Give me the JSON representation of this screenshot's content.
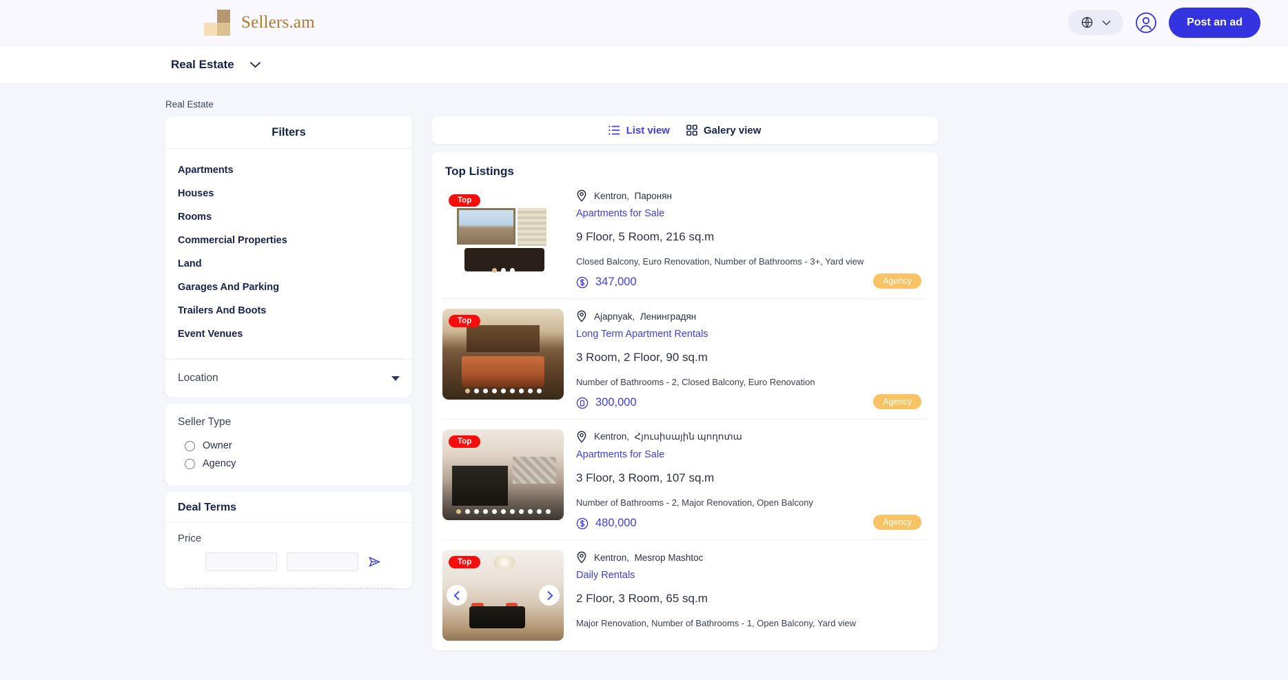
{
  "header": {
    "brand_name": "Sellers.am",
    "language_icon": "globe-icon",
    "post_ad_label": "Post an ad"
  },
  "category_bar": {
    "current_category": "Real Estate"
  },
  "breadcrumb": "Real Estate",
  "sidebar": {
    "filters_title": "Filters",
    "categories": [
      {
        "label": "Apartments"
      },
      {
        "label": "Houses"
      },
      {
        "label": "Rooms"
      },
      {
        "label": "Commercial Properties"
      },
      {
        "label": "Land"
      },
      {
        "label": "Garages And Parking"
      },
      {
        "label": "Trailers And Boots"
      },
      {
        "label": "Event Venues"
      }
    ],
    "location": {
      "label": "Location"
    },
    "seller_type": {
      "title": "Seller Type",
      "options": [
        {
          "label": "Owner",
          "selected": false
        },
        {
          "label": "Agency",
          "selected": false
        }
      ]
    },
    "deal_terms": {
      "title": "Deal Terms",
      "price_label": "Price",
      "price_from": "",
      "price_to": "",
      "price_from_placeholder": "",
      "price_to_placeholder": "",
      "submit_icon": "send-arrow-icon"
    }
  },
  "main": {
    "views": [
      {
        "label": "List view",
        "icon": "list-icon",
        "active": true
      },
      {
        "label": "Galery view",
        "icon": "grid-icon",
        "active": false
      }
    ],
    "listings_title": "Top Listings",
    "listings": [
      {
        "badge": "Top",
        "region": "Kentron",
        "street": "Паронян",
        "title": "Apartments for Sale",
        "specs": "9 Floor, 5 Room, 216 sq.m",
        "attributes": "Closed Balcony,  Euro Renovation,  Number of Bathrooms - 3+,  Yard view",
        "currency_icon": "dollar-circle-icon",
        "price": "347,000",
        "tag": "Agency",
        "dots_total": 3,
        "dots_active": 0
      },
      {
        "badge": "Top",
        "region": "Ajapnyak",
        "street": "Ленинградян",
        "title": "Long Term Apartment Rentals",
        "specs": "3 Room, 2 Floor, 90 sq.m",
        "attributes": "Number of Bathrooms - 2,  Closed Balcony,  Euro Renovation",
        "currency_icon": "dram-circle-icon",
        "price": "300,000",
        "tag": "Agency",
        "dots_total": 9,
        "dots_active": 0
      },
      {
        "badge": "Top",
        "region": "Kentron",
        "street": "Հյուսիսային պողոտա",
        "title": "Apartments for Sale",
        "specs": "3 Floor, 3 Room, 107 sq.m",
        "attributes": "Number of Bathrooms - 2,  Major Renovation,  Open Balcony",
        "currency_icon": "dollar-circle-icon",
        "price": "480,000",
        "tag": "Agency",
        "dots_total": 11,
        "dots_active": 0
      },
      {
        "badge": "Top",
        "region": "Kentron",
        "street": "Mesrop Mashtoc",
        "title": "Daily Rentals",
        "specs": "2 Floor, 3 Room, 65 sq.m",
        "attributes": "Major Renovation,  Number of Bathrooms - 1,  Open Balcony,  Yard view",
        "currency_icon": "dollar-circle-icon",
        "price": "",
        "tag": "",
        "dots_total": 0,
        "dots_active": 0,
        "show_nav_arrows": true
      }
    ]
  },
  "colors": {
    "accent_blue": "#3333e0",
    "link_blue": "#3f3fe8",
    "badge_red": "#fa0c0c",
    "tag_orange": "#f9c262",
    "brand_brown": "#b5792a",
    "page_bg": "#f5f5fc"
  }
}
